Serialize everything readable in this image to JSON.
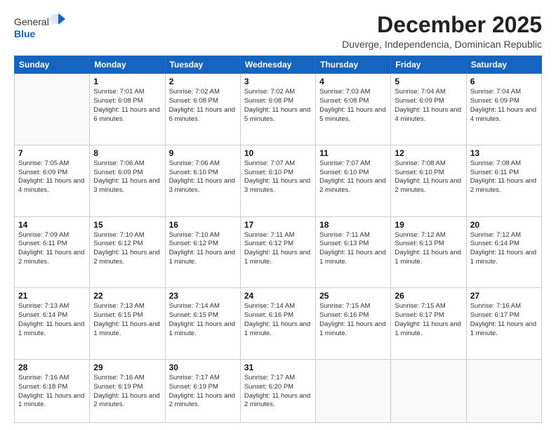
{
  "header": {
    "logo_general": "General",
    "logo_blue": "Blue",
    "month_title": "December 2025",
    "location": "Duverge, Independencia, Dominican Republic"
  },
  "days": [
    "Sunday",
    "Monday",
    "Tuesday",
    "Wednesday",
    "Thursday",
    "Friday",
    "Saturday"
  ],
  "weeks": [
    [
      {
        "date": "",
        "sunrise": "",
        "sunset": "",
        "daylight": ""
      },
      {
        "date": "1",
        "sunrise": "Sunrise: 7:01 AM",
        "sunset": "Sunset: 6:08 PM",
        "daylight": "Daylight: 11 hours and 6 minutes."
      },
      {
        "date": "2",
        "sunrise": "Sunrise: 7:02 AM",
        "sunset": "Sunset: 6:08 PM",
        "daylight": "Daylight: 11 hours and 6 minutes."
      },
      {
        "date": "3",
        "sunrise": "Sunrise: 7:02 AM",
        "sunset": "Sunset: 6:08 PM",
        "daylight": "Daylight: 11 hours and 5 minutes."
      },
      {
        "date": "4",
        "sunrise": "Sunrise: 7:03 AM",
        "sunset": "Sunset: 6:08 PM",
        "daylight": "Daylight: 11 hours and 5 minutes."
      },
      {
        "date": "5",
        "sunrise": "Sunrise: 7:04 AM",
        "sunset": "Sunset: 6:09 PM",
        "daylight": "Daylight: 11 hours and 4 minutes."
      },
      {
        "date": "6",
        "sunrise": "Sunrise: 7:04 AM",
        "sunset": "Sunset: 6:09 PM",
        "daylight": "Daylight: 11 hours and 4 minutes."
      }
    ],
    [
      {
        "date": "7",
        "sunrise": "Sunrise: 7:05 AM",
        "sunset": "Sunset: 6:09 PM",
        "daylight": "Daylight: 11 hours and 4 minutes."
      },
      {
        "date": "8",
        "sunrise": "Sunrise: 7:06 AM",
        "sunset": "Sunset: 6:09 PM",
        "daylight": "Daylight: 11 hours and 3 minutes."
      },
      {
        "date": "9",
        "sunrise": "Sunrise: 7:06 AM",
        "sunset": "Sunset: 6:10 PM",
        "daylight": "Daylight: 11 hours and 3 minutes."
      },
      {
        "date": "10",
        "sunrise": "Sunrise: 7:07 AM",
        "sunset": "Sunset: 6:10 PM",
        "daylight": "Daylight: 11 hours and 3 minutes."
      },
      {
        "date": "11",
        "sunrise": "Sunrise: 7:07 AM",
        "sunset": "Sunset: 6:10 PM",
        "daylight": "Daylight: 11 hours and 2 minutes."
      },
      {
        "date": "12",
        "sunrise": "Sunrise: 7:08 AM",
        "sunset": "Sunset: 6:10 PM",
        "daylight": "Daylight: 11 hours and 2 minutes."
      },
      {
        "date": "13",
        "sunrise": "Sunrise: 7:08 AM",
        "sunset": "Sunset: 6:11 PM",
        "daylight": "Daylight: 11 hours and 2 minutes."
      }
    ],
    [
      {
        "date": "14",
        "sunrise": "Sunrise: 7:09 AM",
        "sunset": "Sunset: 6:11 PM",
        "daylight": "Daylight: 11 hours and 2 minutes."
      },
      {
        "date": "15",
        "sunrise": "Sunrise: 7:10 AM",
        "sunset": "Sunset: 6:12 PM",
        "daylight": "Daylight: 11 hours and 2 minutes."
      },
      {
        "date": "16",
        "sunrise": "Sunrise: 7:10 AM",
        "sunset": "Sunset: 6:12 PM",
        "daylight": "Daylight: 11 hours and 1 minute."
      },
      {
        "date": "17",
        "sunrise": "Sunrise: 7:11 AM",
        "sunset": "Sunset: 6:12 PM",
        "daylight": "Daylight: 11 hours and 1 minute."
      },
      {
        "date": "18",
        "sunrise": "Sunrise: 7:11 AM",
        "sunset": "Sunset: 6:13 PM",
        "daylight": "Daylight: 11 hours and 1 minute."
      },
      {
        "date": "19",
        "sunrise": "Sunrise: 7:12 AM",
        "sunset": "Sunset: 6:13 PM",
        "daylight": "Daylight: 11 hours and 1 minute."
      },
      {
        "date": "20",
        "sunrise": "Sunrise: 7:12 AM",
        "sunset": "Sunset: 6:14 PM",
        "daylight": "Daylight: 11 hours and 1 minute."
      }
    ],
    [
      {
        "date": "21",
        "sunrise": "Sunrise: 7:13 AM",
        "sunset": "Sunset: 6:14 PM",
        "daylight": "Daylight: 11 hours and 1 minute."
      },
      {
        "date": "22",
        "sunrise": "Sunrise: 7:13 AM",
        "sunset": "Sunset: 6:15 PM",
        "daylight": "Daylight: 11 hours and 1 minute."
      },
      {
        "date": "23",
        "sunrise": "Sunrise: 7:14 AM",
        "sunset": "Sunset: 6:15 PM",
        "daylight": "Daylight: 11 hours and 1 minute."
      },
      {
        "date": "24",
        "sunrise": "Sunrise: 7:14 AM",
        "sunset": "Sunset: 6:16 PM",
        "daylight": "Daylight: 11 hours and 1 minute."
      },
      {
        "date": "25",
        "sunrise": "Sunrise: 7:15 AM",
        "sunset": "Sunset: 6:16 PM",
        "daylight": "Daylight: 11 hours and 1 minute."
      },
      {
        "date": "26",
        "sunrise": "Sunrise: 7:15 AM",
        "sunset": "Sunset: 6:17 PM",
        "daylight": "Daylight: 11 hours and 1 minute."
      },
      {
        "date": "27",
        "sunrise": "Sunrise: 7:16 AM",
        "sunset": "Sunset: 6:17 PM",
        "daylight": "Daylight: 11 hours and 1 minute."
      }
    ],
    [
      {
        "date": "28",
        "sunrise": "Sunrise: 7:16 AM",
        "sunset": "Sunset: 6:18 PM",
        "daylight": "Daylight: 11 hours and 1 minute."
      },
      {
        "date": "29",
        "sunrise": "Sunrise: 7:16 AM",
        "sunset": "Sunset: 6:19 PM",
        "daylight": "Daylight: 11 hours and 2 minutes."
      },
      {
        "date": "30",
        "sunrise": "Sunrise: 7:17 AM",
        "sunset": "Sunset: 6:19 PM",
        "daylight": "Daylight: 11 hours and 2 minutes."
      },
      {
        "date": "31",
        "sunrise": "Sunrise: 7:17 AM",
        "sunset": "Sunset: 6:20 PM",
        "daylight": "Daylight: 11 hours and 2 minutes."
      },
      {
        "date": "",
        "sunrise": "",
        "sunset": "",
        "daylight": ""
      },
      {
        "date": "",
        "sunrise": "",
        "sunset": "",
        "daylight": ""
      },
      {
        "date": "",
        "sunrise": "",
        "sunset": "",
        "daylight": ""
      }
    ]
  ]
}
